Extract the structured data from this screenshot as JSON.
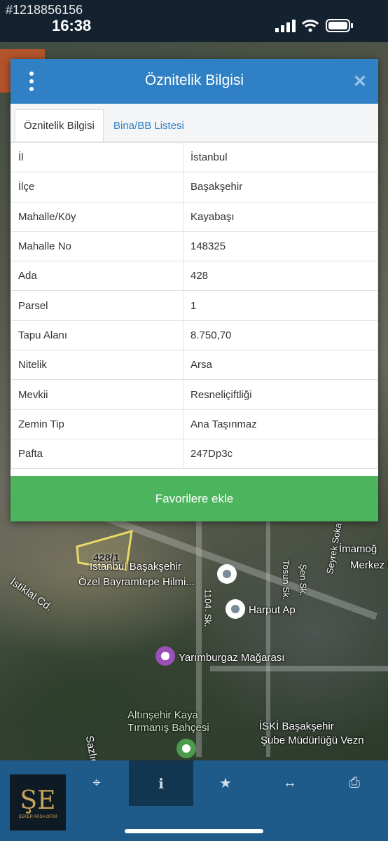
{
  "watermark_id": "#1218856156",
  "status": {
    "time": "16:38"
  },
  "modal": {
    "title": "Öznitelik Bilgisi",
    "tabs": [
      "Öznitelik Bilgisi",
      "Bina/BB Listesi"
    ],
    "rows": [
      {
        "key": "İl",
        "value": "İstanbul"
      },
      {
        "key": "İlçe",
        "value": "Başakşehir"
      },
      {
        "key": "Mahalle/Köy",
        "value": "Kayabaşı"
      },
      {
        "key": "Mahalle No",
        "value": "148325"
      },
      {
        "key": "Ada",
        "value": "428"
      },
      {
        "key": "Parsel",
        "value": "1"
      },
      {
        "key": "Tapu Alanı",
        "value": "8.750,70"
      },
      {
        "key": "Nitelik",
        "value": "Arsa"
      },
      {
        "key": "Mevkii",
        "value": "Resneliçiftliği"
      },
      {
        "key": "Zemin Tip",
        "value": "Ana Taşınmaz"
      },
      {
        "key": "Pafta",
        "value": "247Dp3c"
      }
    ],
    "favorite_label": "Favorilere ekle"
  },
  "map": {
    "parcel_label": "428/1",
    "labels": [
      "İstanbul Başakşehir",
      "Özel Bayramtepe Hilmi...",
      "İstiklal Cd.",
      "1104. Sk.",
      "Harput Ap",
      "Tosun Sk.",
      "Şen Sk.",
      "Seyrek Soka",
      "İmamoğ",
      "Merkez C",
      "Yarımburgaz Mağarası",
      "Altınşehir Kaya",
      "Tırmanış Bahçesi",
      "Sazlıd",
      "İSKİ Başakşehir",
      "Şube Müdürlüğü Vezn"
    ]
  },
  "navbar": {
    "items": [
      "crosshair-icon",
      "info-icon",
      "star-icon",
      "arrows-icon",
      "print-icon"
    ],
    "logo_text": "ŞEKER ARSA OFİSİ"
  },
  "colors": {
    "header": "#2f80c4",
    "favorite": "#4cb45d",
    "navbar": "#1e5a8a"
  }
}
